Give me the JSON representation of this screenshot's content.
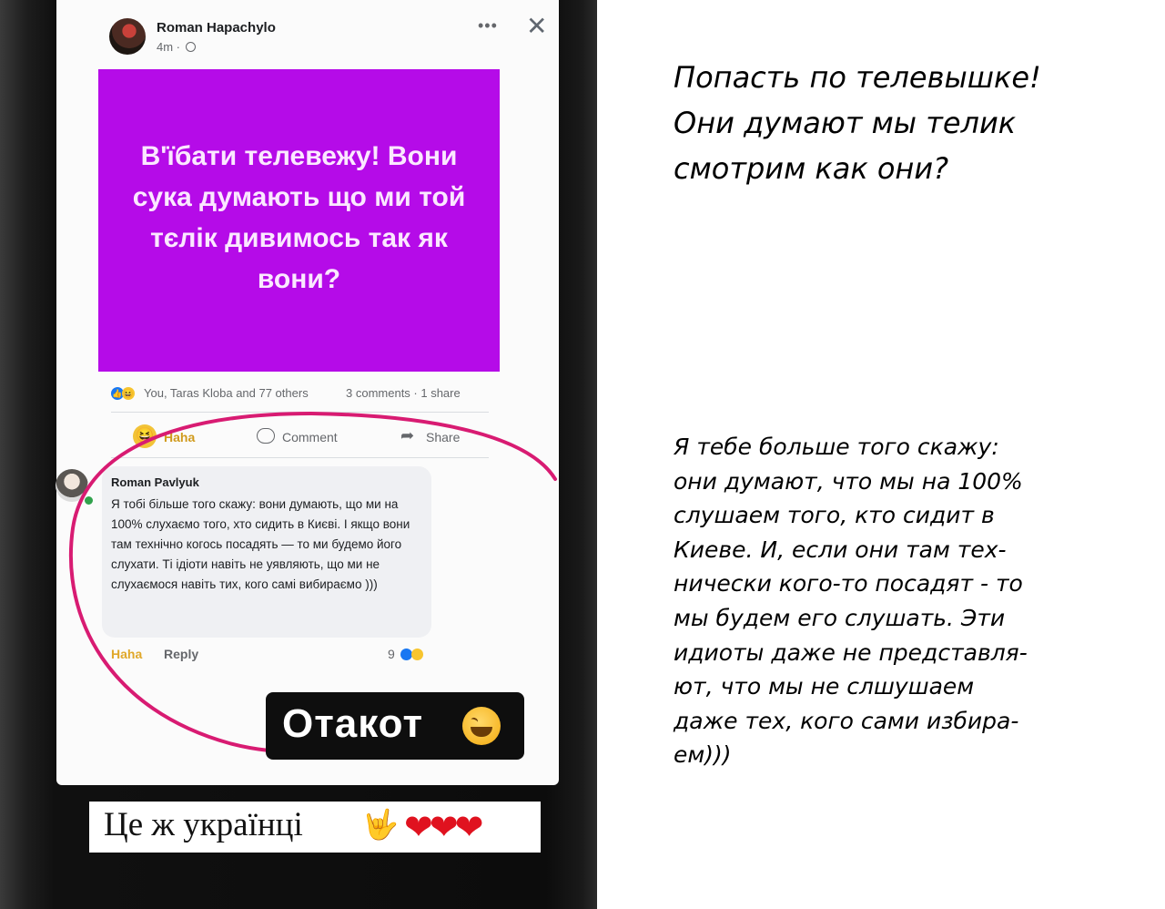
{
  "post": {
    "author": "Roman Hapachylo",
    "time": "4m ·",
    "more_icon": "more-icon",
    "close_icon": "close-icon",
    "text": "В'їбати телевежу! Вони сука думають що ми той тєлік дивимось так як вони?",
    "background_color": "#b50be8",
    "reactions": "You, Taras Kloba and 77 others",
    "counts": "3 comments · 1 share",
    "actions": {
      "haha": "Haha",
      "comment": "Comment",
      "share": "Share"
    }
  },
  "comment": {
    "author": "Roman Pavlyuk",
    "text": "Я тобі більше того скажу: вони думають, що ми на 100% слухаємо того, хто сидить в Києві. І якщо вони там технічно когось посадять — то ми будемо його слухати. Ті ідіоти навіть не уявляють, що ми не слухаємося навіть тих, кого самі вибираємо )))",
    "reaction_label": "Haha",
    "reply_label": "Reply",
    "reaction_count": "9"
  },
  "sticker": {
    "text": "Отакот"
  },
  "caption": {
    "text": "Це ж українці",
    "rock_icon": "🤟",
    "hearts": "❤❤❤"
  },
  "translation": {
    "title": "Попасть по телевышке!\nОни думают мы телик\nсмотрим как они?",
    "body": "Я тебе больше того скажу:\nони думают, что мы на 100%\nслушаем того, кто сидит в\nКиеве. И, если они там тех-\nнически кого-то посадят - то\nмы будем его слушать. Эти\nидиоты даже не представля-\nют, что мы не слшушаем\nдаже тех, кого сами избира-\nем)))"
  },
  "colors": {
    "ellipse": "#d81b72",
    "purple": "#b50be8",
    "phone_frame": "#101010"
  }
}
